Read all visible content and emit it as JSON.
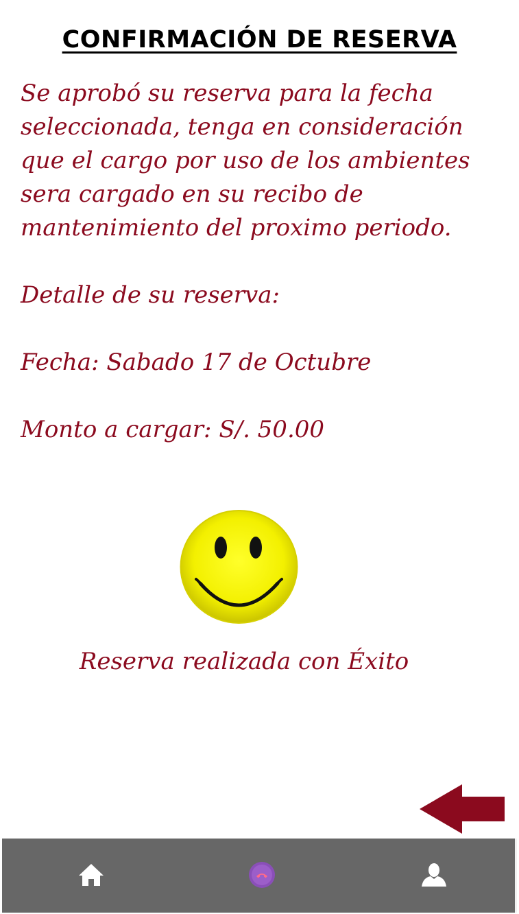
{
  "header": {
    "title": "CONFIRMACIÓN DE RESERVA"
  },
  "message": {
    "line1": "Se aprobó su reserva para la fecha",
    "line2": "seleccionada, tenga en consideración",
    "line3": "que el cargo por uso de los ambientes",
    "line4": "sera cargado en su recibo de",
    "line5": "mantenimiento del proximo periodo."
  },
  "details": {
    "heading": "Detalle de su reserva:",
    "date": "Fecha: Sabado 17 de Octubre",
    "amount": "Monto a cargar: S/. 50.00"
  },
  "status": {
    "icon": "smiley-face-icon",
    "text": "Reserva realizada con Éxito"
  },
  "navigation": {
    "back_icon": "back-arrow-icon",
    "items": [
      {
        "icon": "home-icon"
      },
      {
        "icon": "phone-icon"
      },
      {
        "icon": "user-icon"
      }
    ]
  },
  "colors": {
    "text_accent": "#8b0a1e",
    "title": "#000000",
    "nav_background": "#676767",
    "smiley_yellow": "#f5f200",
    "phone_badge": "#8a4fb8"
  }
}
